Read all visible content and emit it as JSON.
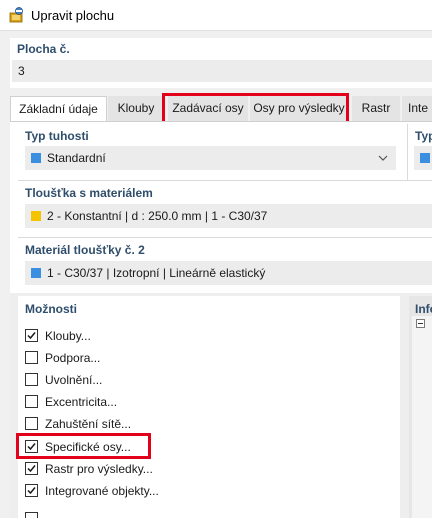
{
  "window": {
    "title": "Upravit plochu"
  },
  "plocha": {
    "label": "Plocha č.",
    "value": "3"
  },
  "tabs": [
    {
      "label": "Základní údaje",
      "active": true
    },
    {
      "label": "Klouby",
      "active": false
    },
    {
      "label": "Zadávací osy",
      "active": false
    },
    {
      "label": "Osy pro výsledky",
      "active": false
    },
    {
      "label": "Rastr",
      "active": false
    },
    {
      "label": "Inte",
      "active": false
    }
  ],
  "typ_tuhosti": {
    "label": "Typ tuhosti",
    "value": "Standardní",
    "swatch": "#3b8fe0"
  },
  "typ_right": {
    "label": "Typ"
  },
  "tloustka": {
    "label": "Tloušťka s materiálem",
    "value": "2 - Konstantní | d : 250.0 mm | 1 - C30/37",
    "swatch": "#f5c400"
  },
  "material": {
    "label": "Materiál tloušťky č. 2",
    "value": "1 - C30/37 | Izotropní | Lineárně elastický",
    "swatch": "#3b8fe0"
  },
  "moznosti": {
    "label": "Možnosti",
    "items": [
      {
        "label": "Klouby...",
        "checked": true
      },
      {
        "label": "Podpora...",
        "checked": false
      },
      {
        "label": "Uvolnění...",
        "checked": false
      },
      {
        "label": "Excentricita...",
        "checked": false
      },
      {
        "label": "Zahuštění sítě...",
        "checked": false
      },
      {
        "label": "Specifické osy...",
        "checked": true
      },
      {
        "label": "Rastr pro výsledky...",
        "checked": true
      },
      {
        "label": "Integrované objekty...",
        "checked": true
      }
    ]
  },
  "info": {
    "label": "Info"
  },
  "colors": {
    "accent_blue": "#3b8fe0",
    "highlight_red": "#e3001b",
    "label_blue": "#2f4e6b"
  }
}
